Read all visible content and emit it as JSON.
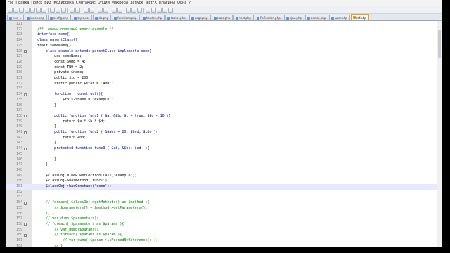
{
  "menu": [
    "File",
    "Правка",
    "Поиск",
    "Вид",
    "Кодировка",
    "Синтаксис",
    "Опции",
    "Макросы",
    "Запуск",
    "TextFX",
    "Плагины",
    "Окна",
    "?"
  ],
  "tabs": [
    {
      "label": "new 1"
    },
    {
      "label": "index.php"
    },
    {
      "label": "config.php"
    },
    {
      "label": "style.css"
    },
    {
      "label": "db.php"
    },
    {
      "label": "functions.php"
    },
    {
      "label": "header.php"
    },
    {
      "label": "footer.php"
    },
    {
      "label": "page.php"
    },
    {
      "label": "class.php"
    },
    {
      "label": "test.php"
    },
    {
      "label": "Reflection.php"
    },
    {
      "label": "ajax.php"
    },
    {
      "label": "admin.php"
    },
    {
      "label": "user.php"
    },
    {
      "label": "ref.php"
    }
  ],
  "active_tab": 15,
  "current_line": 151,
  "lines": [
    {
      "n": 121,
      "t": "",
      "s": ""
    },
    {
      "n": 122,
      "t": "/**  очень полезный класс example */",
      "s": "com"
    },
    {
      "n": 123,
      "t": "interface some{}",
      "s": "kw"
    },
    {
      "n": 124,
      "t": "class parentClass{}",
      "s": "kw"
    },
    {
      "n": 125,
      "t": "trait someName{}",
      "s": ""
    },
    {
      "n": 126,
      "t": "    class example extends parentClass implements some{",
      "s": "kw",
      "fold": true
    },
    {
      "n": 127,
      "t": "        use someName;",
      "s": ""
    },
    {
      "n": 128,
      "t": "        const SOME = 4;",
      "s": ""
    },
    {
      "n": 129,
      "t": "        const TWO = 2;",
      "s": ""
    },
    {
      "n": 130,
      "t": "        private $name;",
      "s": ""
    },
    {
      "n": 131,
      "t": "        public $id = 200;",
      "s": ""
    },
    {
      "n": 132,
      "t": "        static public $stat = '400';",
      "s": ""
    },
    {
      "n": 133,
      "t": "",
      "s": ""
    },
    {
      "n": 134,
      "t": "        function __construct(){",
      "s": "kw",
      "fold": true
    },
    {
      "n": 135,
      "t": "            $this->name = 'example';",
      "s": ""
    },
    {
      "n": 136,
      "t": "        }",
      "s": ""
    },
    {
      "n": 137,
      "t": "",
      "s": ""
    },
    {
      "n": 138,
      "t": "        public function func1 ( $a, &$b, $c = true, $$d = 10 ){",
      "s": "kw",
      "fold": true
    },
    {
      "n": 139,
      "t": "            return $a * $b * $d;",
      "s": ""
    },
    {
      "n": 140,
      "t": "        }",
      "s": ""
    },
    {
      "n": 141,
      "t": "        public function func2 ( &$abc = 20, $bcd, $cde ){",
      "s": "kw",
      "fold": true
    },
    {
      "n": 142,
      "t": "            return 400;",
      "s": ""
    },
    {
      "n": 143,
      "t": "        }",
      "s": ""
    },
    {
      "n": 144,
      "t": "        protected function func3 ( $ab, &$bc, $cd  ){",
      "s": "kw",
      "fold": true
    },
    {
      "n": 145,
      "t": "",
      "s": ""
    },
    {
      "n": 146,
      "t": "        }",
      "s": ""
    },
    {
      "n": 147,
      "t": "    }",
      "s": ""
    },
    {
      "n": 148,
      "t": "",
      "s": ""
    },
    {
      "n": 149,
      "t": "    $classObj = new ReflectionClass('example');",
      "s": ""
    },
    {
      "n": 150,
      "t": "    $classObj->hasMethod('func1');",
      "s": ""
    },
    {
      "n": 151,
      "t": "    $classObj->hasConstant('some');",
      "s": ""
    },
    {
      "n": 152,
      "t": "",
      "s": ""
    },
    {
      "n": 153,
      "t": "",
      "s": ""
    },
    {
      "n": 154,
      "t": "    // foreach( $classObj->getMethods() as $method ){",
      "s": "com",
      "fold": true
    },
    {
      "n": 155,
      "t": "        // $parameters[] = $method->getParameters();",
      "s": "com"
    },
    {
      "n": 156,
      "t": "    // }",
      "s": "com"
    },
    {
      "n": 157,
      "t": "    // var_dump($parameters);",
      "s": "com"
    },
    {
      "n": 158,
      "t": "    // foreach( $parameters as $params ){",
      "s": "com",
      "fold": true
    },
    {
      "n": 159,
      "t": "        // var_dump($params);",
      "s": "com"
    },
    {
      "n": 160,
      "t": "        // foreach( $params as $param ){",
      "s": "com",
      "fold": true
    },
    {
      "n": 161,
      "t": "            // var_dump( $param->isPassedByReference() );",
      "s": "com"
    },
    {
      "n": 162,
      "t": "        // }",
      "s": "com"
    }
  ]
}
